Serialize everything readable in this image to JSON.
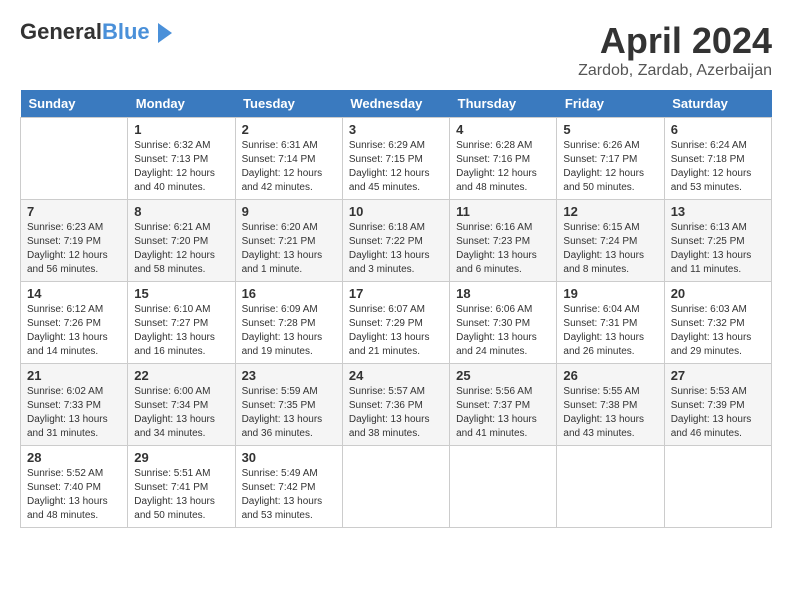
{
  "header": {
    "logo_general": "General",
    "logo_blue": "Blue",
    "month_title": "April 2024",
    "location": "Zardob, Zardab, Azerbaijan"
  },
  "days_of_week": [
    "Sunday",
    "Monday",
    "Tuesday",
    "Wednesday",
    "Thursday",
    "Friday",
    "Saturday"
  ],
  "weeks": [
    [
      {
        "day": "",
        "sunrise": "",
        "sunset": "",
        "daylight": ""
      },
      {
        "day": "1",
        "sunrise": "Sunrise: 6:32 AM",
        "sunset": "Sunset: 7:13 PM",
        "daylight": "Daylight: 12 hours and 40 minutes."
      },
      {
        "day": "2",
        "sunrise": "Sunrise: 6:31 AM",
        "sunset": "Sunset: 7:14 PM",
        "daylight": "Daylight: 12 hours and 42 minutes."
      },
      {
        "day": "3",
        "sunrise": "Sunrise: 6:29 AM",
        "sunset": "Sunset: 7:15 PM",
        "daylight": "Daylight: 12 hours and 45 minutes."
      },
      {
        "day": "4",
        "sunrise": "Sunrise: 6:28 AM",
        "sunset": "Sunset: 7:16 PM",
        "daylight": "Daylight: 12 hours and 48 minutes."
      },
      {
        "day": "5",
        "sunrise": "Sunrise: 6:26 AM",
        "sunset": "Sunset: 7:17 PM",
        "daylight": "Daylight: 12 hours and 50 minutes."
      },
      {
        "day": "6",
        "sunrise": "Sunrise: 6:24 AM",
        "sunset": "Sunset: 7:18 PM",
        "daylight": "Daylight: 12 hours and 53 minutes."
      }
    ],
    [
      {
        "day": "7",
        "sunrise": "Sunrise: 6:23 AM",
        "sunset": "Sunset: 7:19 PM",
        "daylight": "Daylight: 12 hours and 56 minutes."
      },
      {
        "day": "8",
        "sunrise": "Sunrise: 6:21 AM",
        "sunset": "Sunset: 7:20 PM",
        "daylight": "Daylight: 12 hours and 58 minutes."
      },
      {
        "day": "9",
        "sunrise": "Sunrise: 6:20 AM",
        "sunset": "Sunset: 7:21 PM",
        "daylight": "Daylight: 13 hours and 1 minute."
      },
      {
        "day": "10",
        "sunrise": "Sunrise: 6:18 AM",
        "sunset": "Sunset: 7:22 PM",
        "daylight": "Daylight: 13 hours and 3 minutes."
      },
      {
        "day": "11",
        "sunrise": "Sunrise: 6:16 AM",
        "sunset": "Sunset: 7:23 PM",
        "daylight": "Daylight: 13 hours and 6 minutes."
      },
      {
        "day": "12",
        "sunrise": "Sunrise: 6:15 AM",
        "sunset": "Sunset: 7:24 PM",
        "daylight": "Daylight: 13 hours and 8 minutes."
      },
      {
        "day": "13",
        "sunrise": "Sunrise: 6:13 AM",
        "sunset": "Sunset: 7:25 PM",
        "daylight": "Daylight: 13 hours and 11 minutes."
      }
    ],
    [
      {
        "day": "14",
        "sunrise": "Sunrise: 6:12 AM",
        "sunset": "Sunset: 7:26 PM",
        "daylight": "Daylight: 13 hours and 14 minutes."
      },
      {
        "day": "15",
        "sunrise": "Sunrise: 6:10 AM",
        "sunset": "Sunset: 7:27 PM",
        "daylight": "Daylight: 13 hours and 16 minutes."
      },
      {
        "day": "16",
        "sunrise": "Sunrise: 6:09 AM",
        "sunset": "Sunset: 7:28 PM",
        "daylight": "Daylight: 13 hours and 19 minutes."
      },
      {
        "day": "17",
        "sunrise": "Sunrise: 6:07 AM",
        "sunset": "Sunset: 7:29 PM",
        "daylight": "Daylight: 13 hours and 21 minutes."
      },
      {
        "day": "18",
        "sunrise": "Sunrise: 6:06 AM",
        "sunset": "Sunset: 7:30 PM",
        "daylight": "Daylight: 13 hours and 24 minutes."
      },
      {
        "day": "19",
        "sunrise": "Sunrise: 6:04 AM",
        "sunset": "Sunset: 7:31 PM",
        "daylight": "Daylight: 13 hours and 26 minutes."
      },
      {
        "day": "20",
        "sunrise": "Sunrise: 6:03 AM",
        "sunset": "Sunset: 7:32 PM",
        "daylight": "Daylight: 13 hours and 29 minutes."
      }
    ],
    [
      {
        "day": "21",
        "sunrise": "Sunrise: 6:02 AM",
        "sunset": "Sunset: 7:33 PM",
        "daylight": "Daylight: 13 hours and 31 minutes."
      },
      {
        "day": "22",
        "sunrise": "Sunrise: 6:00 AM",
        "sunset": "Sunset: 7:34 PM",
        "daylight": "Daylight: 13 hours and 34 minutes."
      },
      {
        "day": "23",
        "sunrise": "Sunrise: 5:59 AM",
        "sunset": "Sunset: 7:35 PM",
        "daylight": "Daylight: 13 hours and 36 minutes."
      },
      {
        "day": "24",
        "sunrise": "Sunrise: 5:57 AM",
        "sunset": "Sunset: 7:36 PM",
        "daylight": "Daylight: 13 hours and 38 minutes."
      },
      {
        "day": "25",
        "sunrise": "Sunrise: 5:56 AM",
        "sunset": "Sunset: 7:37 PM",
        "daylight": "Daylight: 13 hours and 41 minutes."
      },
      {
        "day": "26",
        "sunrise": "Sunrise: 5:55 AM",
        "sunset": "Sunset: 7:38 PM",
        "daylight": "Daylight: 13 hours and 43 minutes."
      },
      {
        "day": "27",
        "sunrise": "Sunrise: 5:53 AM",
        "sunset": "Sunset: 7:39 PM",
        "daylight": "Daylight: 13 hours and 46 minutes."
      }
    ],
    [
      {
        "day": "28",
        "sunrise": "Sunrise: 5:52 AM",
        "sunset": "Sunset: 7:40 PM",
        "daylight": "Daylight: 13 hours and 48 minutes."
      },
      {
        "day": "29",
        "sunrise": "Sunrise: 5:51 AM",
        "sunset": "Sunset: 7:41 PM",
        "daylight": "Daylight: 13 hours and 50 minutes."
      },
      {
        "day": "30",
        "sunrise": "Sunrise: 5:49 AM",
        "sunset": "Sunset: 7:42 PM",
        "daylight": "Daylight: 13 hours and 53 minutes."
      },
      {
        "day": "",
        "sunrise": "",
        "sunset": "",
        "daylight": ""
      },
      {
        "day": "",
        "sunrise": "",
        "sunset": "",
        "daylight": ""
      },
      {
        "day": "",
        "sunrise": "",
        "sunset": "",
        "daylight": ""
      },
      {
        "day": "",
        "sunrise": "",
        "sunset": "",
        "daylight": ""
      }
    ]
  ]
}
